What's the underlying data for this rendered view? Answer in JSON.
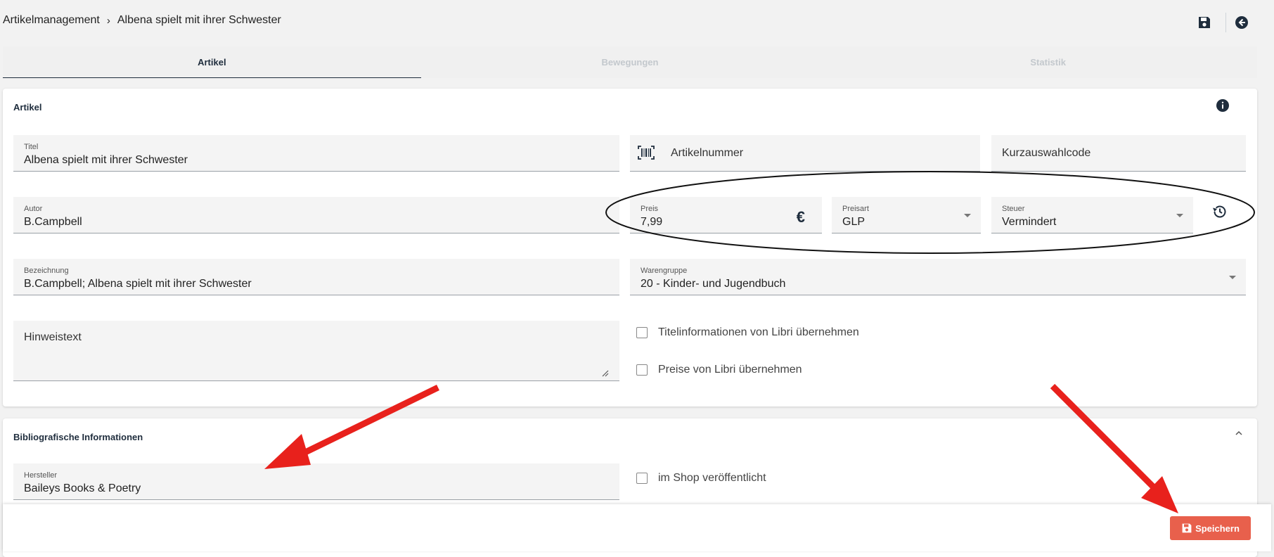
{
  "breadcrumb": {
    "root": "Artikelmanagement",
    "separator": "›",
    "current": "Albena spielt mit ihrer Schwester"
  },
  "tabs": [
    {
      "label": "Artikel",
      "active": true
    },
    {
      "label": "Bewegungen",
      "active": false
    },
    {
      "label": "Statistik",
      "active": false
    }
  ],
  "artikel": {
    "title": "Artikel",
    "titel": {
      "label": "Titel",
      "value": "Albena spielt mit ihrer Schwester"
    },
    "artikelnummer": {
      "placeholder": "Artikelnummer"
    },
    "kurzauswahlcode": {
      "placeholder": "Kurzauswahlcode"
    },
    "autor": {
      "label": "Autor",
      "value": "B.Campbell"
    },
    "preis": {
      "label": "Preis",
      "value": "7,99",
      "currency": "€"
    },
    "preisart": {
      "label": "Preisart",
      "value": "GLP"
    },
    "steuer": {
      "label": "Steuer",
      "value": "Vermindert"
    },
    "bezeichnung": {
      "label": "Bezeichnung",
      "value": "B.Campbell; Albena spielt mit ihrer Schwester"
    },
    "warengruppe": {
      "label": "Warengruppe",
      "value": "20 - Kinder- und Jugendbuch"
    },
    "hinweistext": {
      "placeholder": "Hinweistext"
    },
    "checkbox_titelinfo": "Titelinformationen von Libri übernehmen",
    "checkbox_preise": "Preise von Libri übernehmen"
  },
  "biblio": {
    "title": "Bibliografische Informationen",
    "hersteller": {
      "label": "Hersteller",
      "value": "Baileys Books & Poetry"
    },
    "checkbox_shop": "im Shop veröffentlicht"
  },
  "footer": {
    "save_label": "Speichern"
  },
  "colors": {
    "accent": "#e8604c",
    "annotation_red": "#e8211c",
    "text": "#1f2d3d"
  }
}
